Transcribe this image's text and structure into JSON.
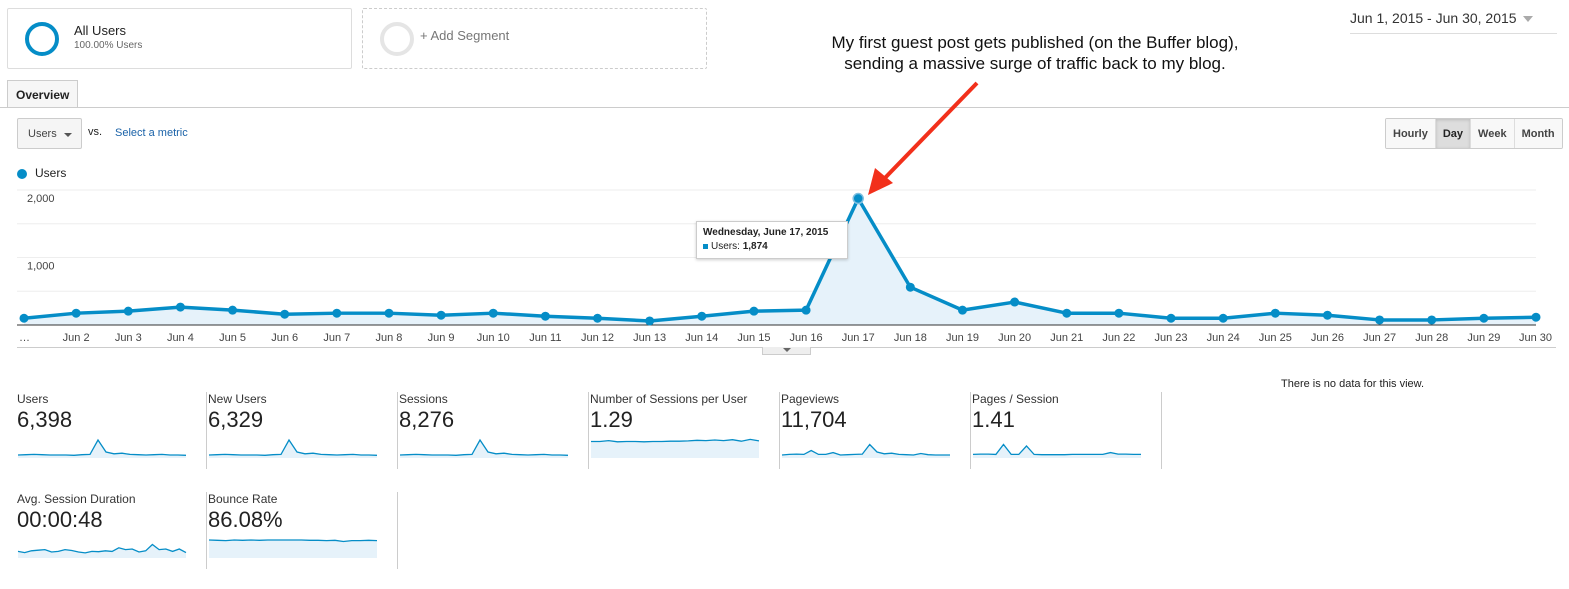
{
  "segments": [
    {
      "title": "All Users",
      "subtitle": "100.00% Users",
      "color": "#058dc7"
    },
    {
      "title": "+ Add Segment"
    }
  ],
  "date_range": "Jun 1, 2015 - Jun 30, 2015",
  "annotation": {
    "line1": "My first guest post gets published (on the Buffer blog),",
    "line2": "sending a massive surge of traffic back to my blog.",
    "arrow_color": "#f2301b"
  },
  "tabs": [
    {
      "label": "Overview",
      "active": true
    }
  ],
  "metric_selector": {
    "selected": "Users",
    "vs_label": "vs.",
    "compare_link": "Select a metric"
  },
  "granularity": {
    "options": [
      "Hourly",
      "Day",
      "Week",
      "Month"
    ],
    "selected": "Day"
  },
  "legend": {
    "label": "Users",
    "color": "#058dc7"
  },
  "tooltip": {
    "date": "Wednesday, June 17, 2015",
    "label": "Users:",
    "value": "1,874"
  },
  "chart_data": {
    "type": "area",
    "title": "",
    "xlabel": "",
    "ylabel": "Users",
    "ylim": [
      0,
      2000
    ],
    "yticks": [
      "2,000",
      "1,000"
    ],
    "ytick_values": [
      2000,
      1000
    ],
    "grid": true,
    "x": [
      "…",
      "Jun 2",
      "Jun 3",
      "Jun 4",
      "Jun 5",
      "Jun 6",
      "Jun 7",
      "Jun 8",
      "Jun 9",
      "Jun 10",
      "Jun 11",
      "Jun 12",
      "Jun 13",
      "Jun 14",
      "Jun 15",
      "Jun 16",
      "Jun 17",
      "Jun 18",
      "Jun 19",
      "Jun 20",
      "Jun 21",
      "Jun 22",
      "Jun 23",
      "Jun 24",
      "Jun 25",
      "Jun 26",
      "Jun 27",
      "Jun 28",
      "Jun 29",
      "Jun 30"
    ],
    "series": [
      {
        "name": "Users",
        "color": "#058dc7",
        "values": [
          100,
          175,
          205,
          265,
          220,
          160,
          175,
          175,
          145,
          175,
          130,
          100,
          60,
          130,
          205,
          220,
          1874,
          560,
          220,
          340,
          175,
          175,
          100,
          100,
          175,
          145,
          75,
          75,
          100,
          115
        ]
      }
    ],
    "highlighted_point": {
      "x": "Jun 17",
      "value": 1874
    }
  },
  "kpis": [
    {
      "label": "Users",
      "value": "6,398",
      "trend": [
        10,
        11,
        12,
        11,
        10,
        10,
        10,
        9,
        11,
        12,
        60,
        20,
        14,
        16,
        12,
        11,
        10,
        11,
        12,
        10,
        10,
        9
      ],
      "area_fill": false
    },
    {
      "label": "New Users",
      "value": "6,329",
      "trend": [
        10,
        11,
        12,
        11,
        10,
        10,
        10,
        9,
        11,
        12,
        60,
        20,
        14,
        16,
        12,
        11,
        10,
        11,
        12,
        10,
        10,
        9
      ],
      "area_fill": false
    },
    {
      "label": "Sessions",
      "value": "8,276",
      "trend": [
        10,
        11,
        12,
        11,
        10,
        10,
        10,
        9,
        11,
        12,
        60,
        20,
        14,
        16,
        12,
        11,
        10,
        11,
        12,
        10,
        10,
        9
      ],
      "area_fill": false
    },
    {
      "label": "Number of Sessions per User",
      "value": "1.29",
      "trend": [
        55,
        55,
        58,
        54,
        55,
        55,
        54,
        55,
        55,
        56,
        56,
        57,
        59,
        58,
        60,
        58,
        61,
        56,
        62,
        57
      ],
      "area_fill": true
    },
    {
      "label": "Pageviews",
      "value": "11,704",
      "trend": [
        10,
        12,
        13,
        12,
        25,
        12,
        12,
        18,
        10,
        11,
        12,
        13,
        45,
        20,
        14,
        16,
        12,
        11,
        10,
        15,
        11,
        10,
        10,
        10
      ],
      "area_fill": false
    },
    {
      "label": "Pages / Session",
      "value": "1.41",
      "trend": [
        12,
        13,
        13,
        12,
        45,
        12,
        12,
        40,
        12,
        11,
        11,
        11,
        11,
        12,
        12,
        12,
        12,
        12,
        18,
        13,
        13,
        12,
        12
      ],
      "area_fill": false
    },
    {
      "label": "Avg. Session Duration",
      "value": "00:00:48",
      "trend": [
        22,
        18,
        24,
        26,
        28,
        20,
        22,
        28,
        25,
        20,
        17,
        22,
        21,
        24,
        22,
        34,
        28,
        30,
        20,
        24,
        45,
        28,
        30,
        22,
        30,
        18
      ],
      "area_fill": false
    },
    {
      "label": "Bounce Rate",
      "value": "86.08%",
      "trend": [
        60,
        59,
        58,
        60,
        59,
        60,
        59,
        60,
        60,
        60,
        60,
        60,
        59,
        59,
        58,
        59,
        55,
        58,
        58,
        59,
        58
      ],
      "area_fill": true
    }
  ],
  "no_data_message": "There is no data for this view."
}
